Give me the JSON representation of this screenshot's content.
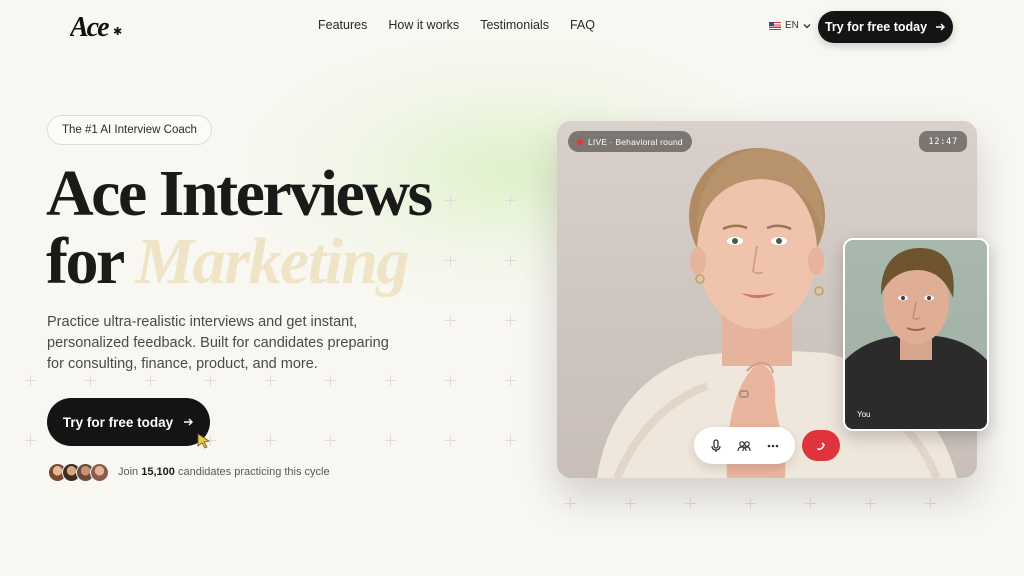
{
  "header": {
    "logo_text": "Ace",
    "nav": [
      "Features",
      "How it works",
      "Testimonials",
      "FAQ"
    ],
    "language": "EN",
    "cta_label": "Try for free today"
  },
  "hero": {
    "badge": "The #1 AI Interview Coach",
    "headline_line1": "Ace Interviews",
    "headline_for": "for",
    "headline_accent": "Marketing",
    "subtext": "Practice ultra-realistic interviews and get instant, personalized feedback. Built for candidates preparing for consulting, finance, product, and more.",
    "cta_label": "Try for free today",
    "social_prefix": "Join",
    "social_count": "15,100",
    "social_suffix": "candidates practicing this cycle"
  },
  "video": {
    "live_label": "LIVE · Behavioral round",
    "timer": "12:47",
    "self_label": "You"
  },
  "colors": {
    "accent_text": "#efe5c6",
    "button_dark": "#141414",
    "end_call": "#e0343c",
    "live_dot": "#e53935"
  },
  "icons": [
    "microphone-icon",
    "participants-icon",
    "more-icon",
    "end-call-icon",
    "arrow-right-icon",
    "cursor-icon",
    "chevron-down-icon",
    "us-flag-icon"
  ]
}
